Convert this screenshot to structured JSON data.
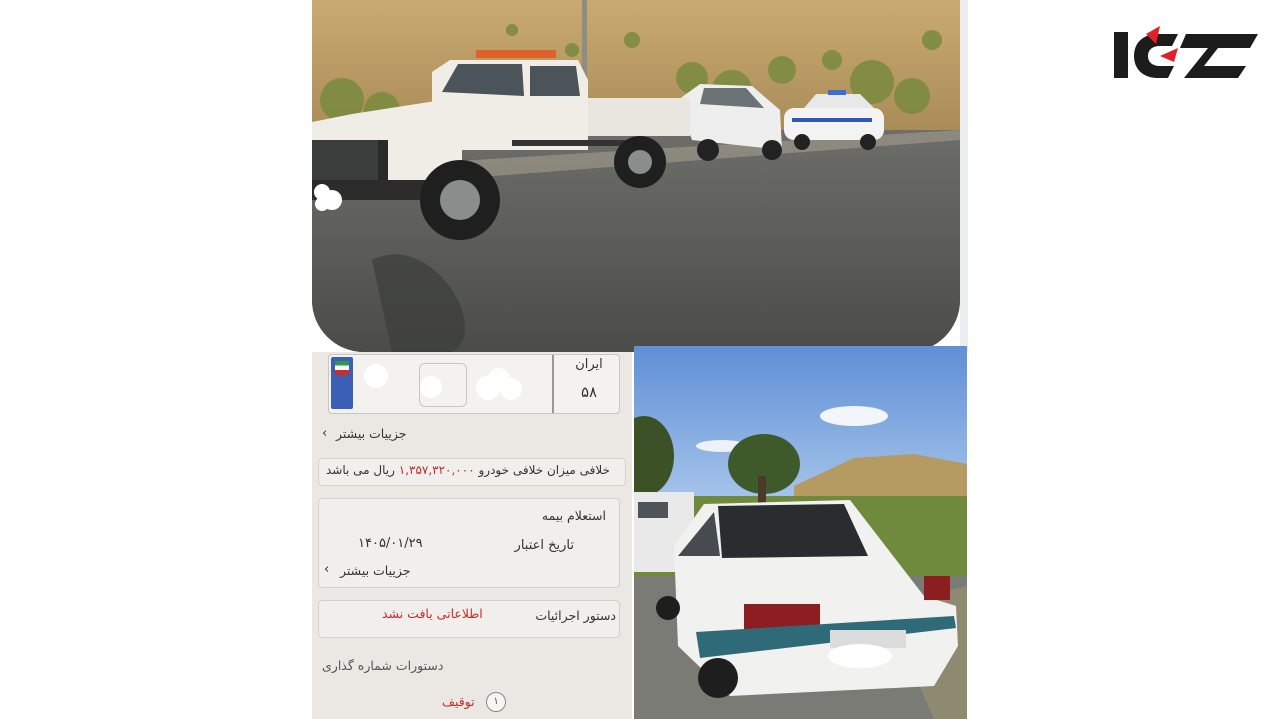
{
  "logo": {
    "icon": "rokna-logo",
    "color": "#e0202a",
    "dark": "#1c1c1c"
  },
  "doc_screenshot": {
    "plate": {
      "country": "ایران",
      "code": "۵۸"
    },
    "more_details_1": "جزییات بیشتر",
    "violation_text_pre": "خلافی میزان خلافی خودرو",
    "violation_amount": "۱,۳۵۷,۳۲۰,۰۰۰",
    "violation_text_post": "ریال می باشد",
    "insurance_title": "استعلام بیمه",
    "validity_label": "تاریخ اعتبار",
    "validity_date": "۱۴۰۵/۰۱/۲۹",
    "more_details_2": "جزییات بیشتر",
    "execution_label": "دستور اجرائیات",
    "execution_value": "اطلاعاتی یافت نشد",
    "plate_orders_label": "دستورات شماره گذاری",
    "seize_label": "توقیف",
    "seize_index": "۱"
  },
  "photos": {
    "top": "tow-truck-with-sedan-and-police-car",
    "bottom_right": "white-sedan-rear-view"
  }
}
